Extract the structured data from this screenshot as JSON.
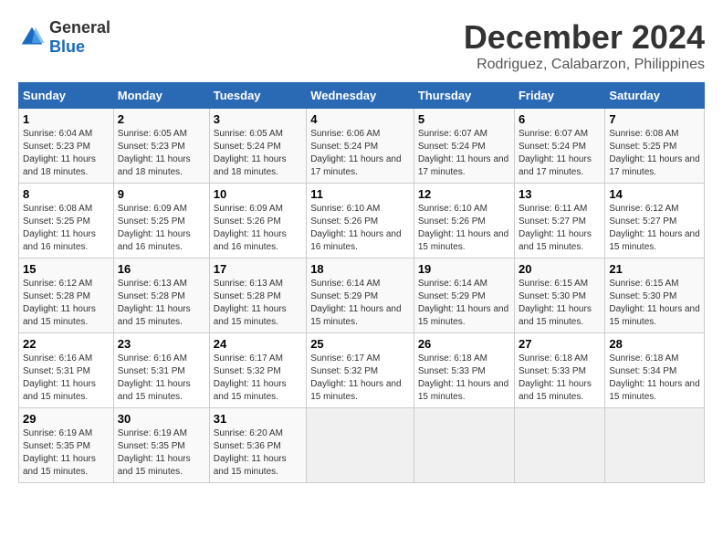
{
  "logo": {
    "general": "General",
    "blue": "Blue"
  },
  "title": {
    "month": "December 2024",
    "location": "Rodriguez, Calabarzon, Philippines"
  },
  "days_of_week": [
    "Sunday",
    "Monday",
    "Tuesday",
    "Wednesday",
    "Thursday",
    "Friday",
    "Saturday"
  ],
  "weeks": [
    [
      {
        "day": "1",
        "sunrise": "6:04 AM",
        "sunset": "5:23 PM",
        "daylight": "11 hours and 18 minutes."
      },
      {
        "day": "2",
        "sunrise": "6:05 AM",
        "sunset": "5:23 PM",
        "daylight": "11 hours and 18 minutes."
      },
      {
        "day": "3",
        "sunrise": "6:05 AM",
        "sunset": "5:24 PM",
        "daylight": "11 hours and 18 minutes."
      },
      {
        "day": "4",
        "sunrise": "6:06 AM",
        "sunset": "5:24 PM",
        "daylight": "11 hours and 17 minutes."
      },
      {
        "day": "5",
        "sunrise": "6:07 AM",
        "sunset": "5:24 PM",
        "daylight": "11 hours and 17 minutes."
      },
      {
        "day": "6",
        "sunrise": "6:07 AM",
        "sunset": "5:24 PM",
        "daylight": "11 hours and 17 minutes."
      },
      {
        "day": "7",
        "sunrise": "6:08 AM",
        "sunset": "5:25 PM",
        "daylight": "11 hours and 17 minutes."
      }
    ],
    [
      {
        "day": "8",
        "sunrise": "6:08 AM",
        "sunset": "5:25 PM",
        "daylight": "11 hours and 16 minutes."
      },
      {
        "day": "9",
        "sunrise": "6:09 AM",
        "sunset": "5:25 PM",
        "daylight": "11 hours and 16 minutes."
      },
      {
        "day": "10",
        "sunrise": "6:09 AM",
        "sunset": "5:26 PM",
        "daylight": "11 hours and 16 minutes."
      },
      {
        "day": "11",
        "sunrise": "6:10 AM",
        "sunset": "5:26 PM",
        "daylight": "11 hours and 16 minutes."
      },
      {
        "day": "12",
        "sunrise": "6:10 AM",
        "sunset": "5:26 PM",
        "daylight": "11 hours and 15 minutes."
      },
      {
        "day": "13",
        "sunrise": "6:11 AM",
        "sunset": "5:27 PM",
        "daylight": "11 hours and 15 minutes."
      },
      {
        "day": "14",
        "sunrise": "6:12 AM",
        "sunset": "5:27 PM",
        "daylight": "11 hours and 15 minutes."
      }
    ],
    [
      {
        "day": "15",
        "sunrise": "6:12 AM",
        "sunset": "5:28 PM",
        "daylight": "11 hours and 15 minutes."
      },
      {
        "day": "16",
        "sunrise": "6:13 AM",
        "sunset": "5:28 PM",
        "daylight": "11 hours and 15 minutes."
      },
      {
        "day": "17",
        "sunrise": "6:13 AM",
        "sunset": "5:28 PM",
        "daylight": "11 hours and 15 minutes."
      },
      {
        "day": "18",
        "sunrise": "6:14 AM",
        "sunset": "5:29 PM",
        "daylight": "11 hours and 15 minutes."
      },
      {
        "day": "19",
        "sunrise": "6:14 AM",
        "sunset": "5:29 PM",
        "daylight": "11 hours and 15 minutes."
      },
      {
        "day": "20",
        "sunrise": "6:15 AM",
        "sunset": "5:30 PM",
        "daylight": "11 hours and 15 minutes."
      },
      {
        "day": "21",
        "sunrise": "6:15 AM",
        "sunset": "5:30 PM",
        "daylight": "11 hours and 15 minutes."
      }
    ],
    [
      {
        "day": "22",
        "sunrise": "6:16 AM",
        "sunset": "5:31 PM",
        "daylight": "11 hours and 15 minutes."
      },
      {
        "day": "23",
        "sunrise": "6:16 AM",
        "sunset": "5:31 PM",
        "daylight": "11 hours and 15 minutes."
      },
      {
        "day": "24",
        "sunrise": "6:17 AM",
        "sunset": "5:32 PM",
        "daylight": "11 hours and 15 minutes."
      },
      {
        "day": "25",
        "sunrise": "6:17 AM",
        "sunset": "5:32 PM",
        "daylight": "11 hours and 15 minutes."
      },
      {
        "day": "26",
        "sunrise": "6:18 AM",
        "sunset": "5:33 PM",
        "daylight": "11 hours and 15 minutes."
      },
      {
        "day": "27",
        "sunrise": "6:18 AM",
        "sunset": "5:33 PM",
        "daylight": "11 hours and 15 minutes."
      },
      {
        "day": "28",
        "sunrise": "6:18 AM",
        "sunset": "5:34 PM",
        "daylight": "11 hours and 15 minutes."
      }
    ],
    [
      {
        "day": "29",
        "sunrise": "6:19 AM",
        "sunset": "5:35 PM",
        "daylight": "11 hours and 15 minutes."
      },
      {
        "day": "30",
        "sunrise": "6:19 AM",
        "sunset": "5:35 PM",
        "daylight": "11 hours and 15 minutes."
      },
      {
        "day": "31",
        "sunrise": "6:20 AM",
        "sunset": "5:36 PM",
        "daylight": "11 hours and 15 minutes."
      },
      null,
      null,
      null,
      null
    ]
  ]
}
